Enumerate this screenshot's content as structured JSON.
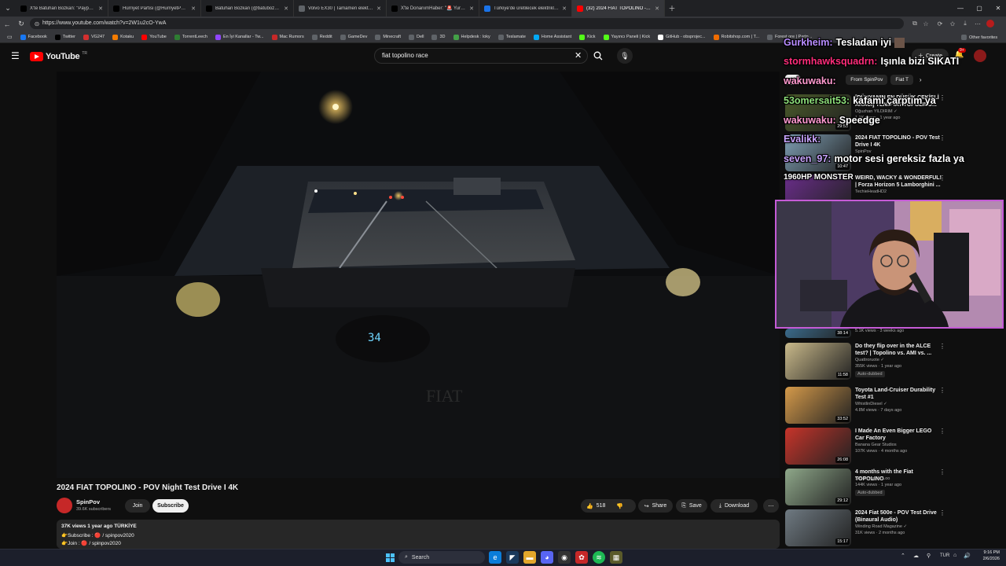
{
  "browser": {
    "tabs": [
      {
        "title": "X'te Batuhan Bozkan: \"Paypal, Ap...",
        "fav": "x-icon",
        "color": "#000000"
      },
      {
        "title": "Hürriyet Partisi (@HurriyetPartisi)",
        "fav": "x-icon",
        "color": "#000000"
      },
      {
        "title": "Batuhan Bozkan (@batubozkan) / ...",
        "fav": "x-icon",
        "color": "#000000"
      },
      {
        "title": "Volvo EX30 | Tamamen elektrikli k...",
        "fav": "globe-icon",
        "color": "#5f6368"
      },
      {
        "title": "X'te DonanımHaber: \"🚨 Yurtdışı...",
        "fav": "x-icon",
        "color": "#000000"
      },
      {
        "title": "Türkiye'de üretilecek elektrikli Hy...",
        "fav": "globe-icon",
        "color": "#1a73e8"
      },
      {
        "title": "(32) 2024 FIAT TOPOLINO - P...",
        "fav": "youtube-icon",
        "color": "#ff0000",
        "active": true
      }
    ],
    "url": "https://www.youtube.com/watch?v=2W1u2cO-YwA",
    "bookmarks": [
      {
        "label": "Facebook",
        "color": "#1877f2"
      },
      {
        "label": "Twitter",
        "color": "#000000"
      },
      {
        "label": "VG247",
        "color": "#d32f2f"
      },
      {
        "label": "Kotaku",
        "color": "#f57c00"
      },
      {
        "label": "YouTube",
        "color": "#ff0000"
      },
      {
        "label": "TorrentLeech",
        "color": "#2e7d32"
      },
      {
        "label": "En İyi Kanallar - Tw...",
        "color": "#9146ff"
      },
      {
        "label": "Mac Rumors",
        "color": "#c62828"
      },
      {
        "label": "Reddit",
        "color": "#5f6368"
      },
      {
        "label": "GameDev",
        "color": "#5f6368"
      },
      {
        "label": "Minecraft",
        "color": "#5f6368"
      },
      {
        "label": "Dell",
        "color": "#5f6368"
      },
      {
        "label": "3D",
        "color": "#5f6368"
      },
      {
        "label": "Helpdesk : loky",
        "color": "#43a047"
      },
      {
        "label": "Teslamate",
        "color": "#5f6368"
      },
      {
        "label": "Home Assistant",
        "color": "#03a9f4"
      },
      {
        "label": "Kick",
        "color": "#53fc18"
      },
      {
        "label": "Yayıncı Paneli | Kick",
        "color": "#53fc18"
      },
      {
        "label": "GitHub - obsprojec...",
        "color": "#ffffff"
      },
      {
        "label": "Robitshop.com | T...",
        "color": "#ef6c00"
      },
      {
        "label": "Forest ore | Partn...",
        "color": "#5f6368"
      }
    ],
    "other_bookmarks": "Other favorites"
  },
  "youtube": {
    "logo_text": "YouTube",
    "logo_region": "TR",
    "search_value": "fiat topolino race",
    "create_label": "Create",
    "notif_count": "9+"
  },
  "video": {
    "title": "2024 FIAT TOPOLINO - POV Night Test Drive I 4K",
    "channel": "SpinPov",
    "subscribers": "39.6K subscribers",
    "join": "Join",
    "subscribe": "Subscribe",
    "likes": "518",
    "share": "Share",
    "save": "Save",
    "download": "Download",
    "views_line": "37K views  1 year ago  TÜRKİYE",
    "desc1": "👉Subscribe : 🔴 / spinpov2020",
    "desc2": "👉Join : 🔴 / spinpov2020",
    "speedo": "34"
  },
  "sidebar": {
    "chips": [
      "All",
      "From SpinPov",
      "Fiat T"
    ],
    "recs": [
      {
        "title": "[DÜNYANIN EN DÜŞÜK ÇEKİŞLİ ARACI] YENİ FIAT TOPOLINO...",
        "channel": "Oğuzhan YILDIRIM ✓",
        "meta": "1.1K views · 1 year ago",
        "dur": "29:55",
        "thumb": "#4a5a2a"
      },
      {
        "title": "2024 FIAT TOPOLINO - POV Test Drive I 4K",
        "channel": "SpinPov",
        "meta": "",
        "dur": "10:47",
        "thumb": "#7fa0b5"
      },
      {
        "title": "WEIRD, WACKY & WONDERFUL! | Forza Horizon 5 Lamborghini ...",
        "channel": "TechieHeadHD2",
        "meta": "",
        "dur": "",
        "thumb": "#6a2d8a"
      },
      {
        "title": "",
        "channel": "",
        "meta": "5.1K views · 3 weeks ago",
        "dur": "38:14",
        "thumb": "#3a6a8a"
      },
      {
        "title": "Do they flip over in the ALCE test? | Topolino vs. AMI vs. ...",
        "channel": "Quattroruote ✓",
        "meta": "355K views · 1 year ago",
        "badge": "Auto-dubbed",
        "dur": "11:58",
        "thumb": "#c9b98a"
      },
      {
        "title": "Toyota Land-Cruiser Durability Test #1",
        "channel": "WhistlinDiesel ✓",
        "meta": "4.8M views · 7 days ago",
        "dur": "33:52",
        "thumb": "#d59a4a"
      },
      {
        "title": "I Made An Even Bigger LEGO Car Factory",
        "channel": "Banana Gear Studios",
        "meta": "107K views · 4 months ago",
        "dur": "26:08",
        "thumb": "#c7342a"
      },
      {
        "title": "4 months with the Fiat TOPOLINO",
        "channel": "Simon van de Loo",
        "meta": "144K views · 1 year ago",
        "badge": "Auto-dubbed",
        "dur": "29:12",
        "thumb": "#8fa88a"
      },
      {
        "title": "2024 Fiat 500e - POV Test Drive (Binaural Audio)",
        "channel": "Winding Road Magazine ✓",
        "meta": "31K views · 2 months ago",
        "dur": "15:17",
        "thumb": "#6f7a82"
      }
    ]
  },
  "chat": [
    {
      "user": "Gurkheim:",
      "msg": "Tesladan iyi",
      "color": "#b88cff",
      "emote": true
    },
    {
      "user": "stormhawksquadrn:",
      "msg": "Işınla bizi SIKATI",
      "color": "#ff2d7a"
    },
    {
      "user": "wakuwaku:",
      "msg": "",
      "color": "#ff9ad0"
    },
    {
      "user": "53omersait53:",
      "msg": "kafamı çarptım ya",
      "color": "#8ee07a"
    },
    {
      "user": "wakuwaku:",
      "msg": "Speedge",
      "color": "#ff9ad0"
    },
    {
      "user": "Evalikk:",
      "msg": "",
      "color": "#c9a5ff"
    },
    {
      "user": "seven_97:",
      "msg": "motor sesi gereksiz fazla ya",
      "color": "#c9a5ff"
    },
    {
      "user": "1960HP MONSTER",
      "msg": "",
      "color": "#ffffff"
    }
  ],
  "taskbar": {
    "search": "Search",
    "lang": "TUR",
    "time": "9:16 PM",
    "date": "2/6/2026"
  }
}
